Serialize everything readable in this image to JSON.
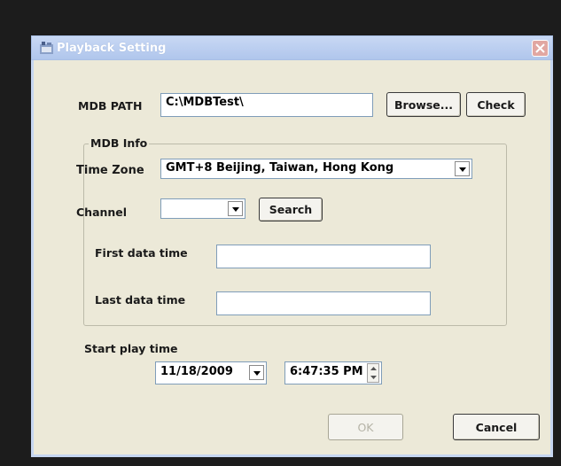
{
  "window": {
    "title": "Playback Setting"
  },
  "mdb_path": {
    "label": "MDB PATH",
    "value": "C:\\MDBTest\\",
    "browse_label": "Browse...",
    "check_label": "Check"
  },
  "mdb_info": {
    "group_label": "MDB Info",
    "time_zone": {
      "label": "Time Zone",
      "value": "GMT+8 Beijing, Taiwan, Hong Kong"
    },
    "channel": {
      "label": "Channel",
      "value": "",
      "search_label": "Search"
    },
    "first_data_time": {
      "label": "First data time",
      "value": ""
    },
    "last_data_time": {
      "label": "Last data time",
      "value": ""
    }
  },
  "start_play_time": {
    "label": "Start play time",
    "date": "11/18/2009",
    "time": "6:47:35 PM"
  },
  "buttons": {
    "ok_label": "OK",
    "cancel_label": "Cancel"
  },
  "icons": {
    "app": "app-icon",
    "close": "close-icon",
    "dropdown": "chevron-down-icon",
    "spin_up": "spin-up-icon",
    "spin_down": "spin-down-icon"
  },
  "colors": {
    "dialog_bg": "#ece9d8",
    "titlebar": "#c8d8f4",
    "close_button": "#e1a7a2",
    "backdrop": "#1c1c1c"
  }
}
